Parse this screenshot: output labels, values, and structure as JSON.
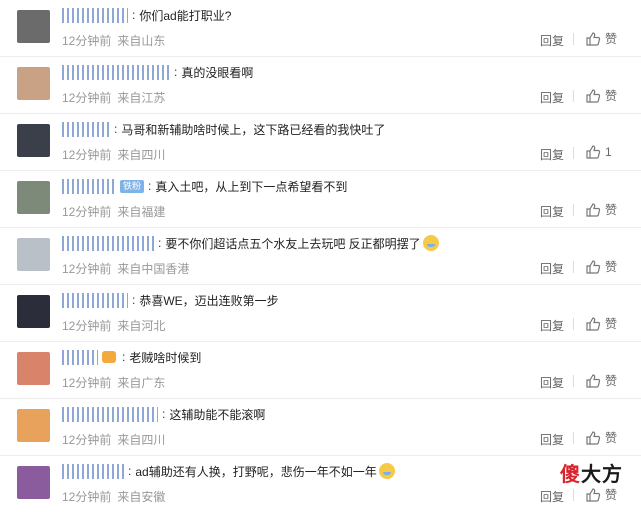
{
  "comments": [
    {
      "text": "你们ad能打职业?",
      "time": "12分钟前",
      "source": "来自山东",
      "reply": "回复",
      "like": "赞",
      "avatar_color": "#6b6b6b",
      "name_width": 66
    },
    {
      "text": "真的没眼看啊",
      "time": "12分钟前",
      "source": "来自江苏",
      "reply": "回复",
      "like": "赞",
      "avatar_color": "#c9a184",
      "name_width": 108
    },
    {
      "text": "马哥和新辅助啥时候上，这下路已经看的我快吐了",
      "time": "12分钟前",
      "source": "来自四川",
      "reply": "回复",
      "like": "1",
      "avatar_color": "#3a3f4a",
      "name_width": 48
    },
    {
      "text": "真入土吧，从上到下一点希望看不到",
      "time": "12分钟前",
      "source": "来自福建",
      "reply": "回复",
      "like": "赞",
      "avatar_color": "#7d8a7a",
      "name_width": 54,
      "badge": "铁粉"
    },
    {
      "text": "要不你们超话点五个水友上去玩吧 反正都明摆了",
      "time": "12分钟前",
      "source": "来自中国香港",
      "reply": "回复",
      "like": "赞",
      "avatar_color": "#b9c0c8",
      "name_width": 92,
      "emoji": "crying-emoji"
    },
    {
      "text": "恭喜WE，迈出连败第一步",
      "time": "12分钟前",
      "source": "来自河北",
      "reply": "回复",
      "like": "赞",
      "avatar_color": "#2b2e3a",
      "name_width": 66
    },
    {
      "text": "老贼啥时候到",
      "time": "12分钟前",
      "source": "来自广东",
      "reply": "回复",
      "like": "赞",
      "avatar_color": "#d9846a",
      "name_width": 36,
      "level": true
    },
    {
      "text": "这辅助能不能滚啊",
      "time": "12分钟前",
      "source": "来自四川",
      "reply": "回复",
      "like": "赞",
      "avatar_color": "#e8a25c",
      "name_width": 96
    },
    {
      "text": "ad辅助还有人换，打野呢，悲伤一年不如一年",
      "time": "12分钟前",
      "source": "来自安徽",
      "reply": "回复",
      "like": "赞",
      "avatar_color": "#8a5c9e",
      "name_width": 62,
      "emoji": "crying-emoji"
    }
  ],
  "watermark": {
    "part1": "傻",
    "part2": "大方"
  }
}
